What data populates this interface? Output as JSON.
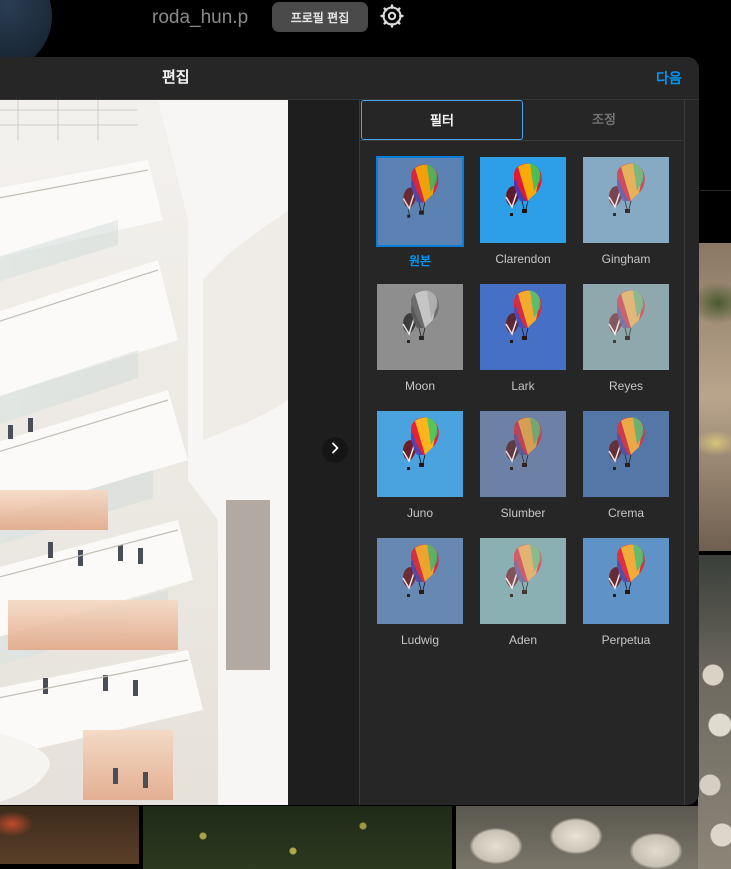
{
  "profile": {
    "username": "roda_hun.p",
    "edit_profile_label": "프로필 편집"
  },
  "modal": {
    "title": "편집",
    "next_label": "다음"
  },
  "tabs": [
    {
      "label": "필터",
      "active": true
    },
    {
      "label": "조정",
      "active": false
    }
  ],
  "filters": [
    {
      "label": "원본",
      "selected": true
    },
    {
      "label": "Clarendon",
      "selected": false
    },
    {
      "label": "Gingham",
      "selected": false
    },
    {
      "label": "Moon",
      "selected": false
    },
    {
      "label": "Lark",
      "selected": false
    },
    {
      "label": "Reyes",
      "selected": false
    },
    {
      "label": "Juno",
      "selected": false
    },
    {
      "label": "Slumber",
      "selected": false
    },
    {
      "label": "Crema",
      "selected": false
    },
    {
      "label": "Ludwig",
      "selected": false
    },
    {
      "label": "Aden",
      "selected": false
    },
    {
      "label": "Perpetua",
      "selected": false
    }
  ],
  "colors": {
    "accent": "#0095f6",
    "modal_bg": "#262626",
    "page_bg": "#000000"
  },
  "icons": {
    "settings": "settings-gear-icon",
    "next_photo": "chevron-right-icon"
  }
}
